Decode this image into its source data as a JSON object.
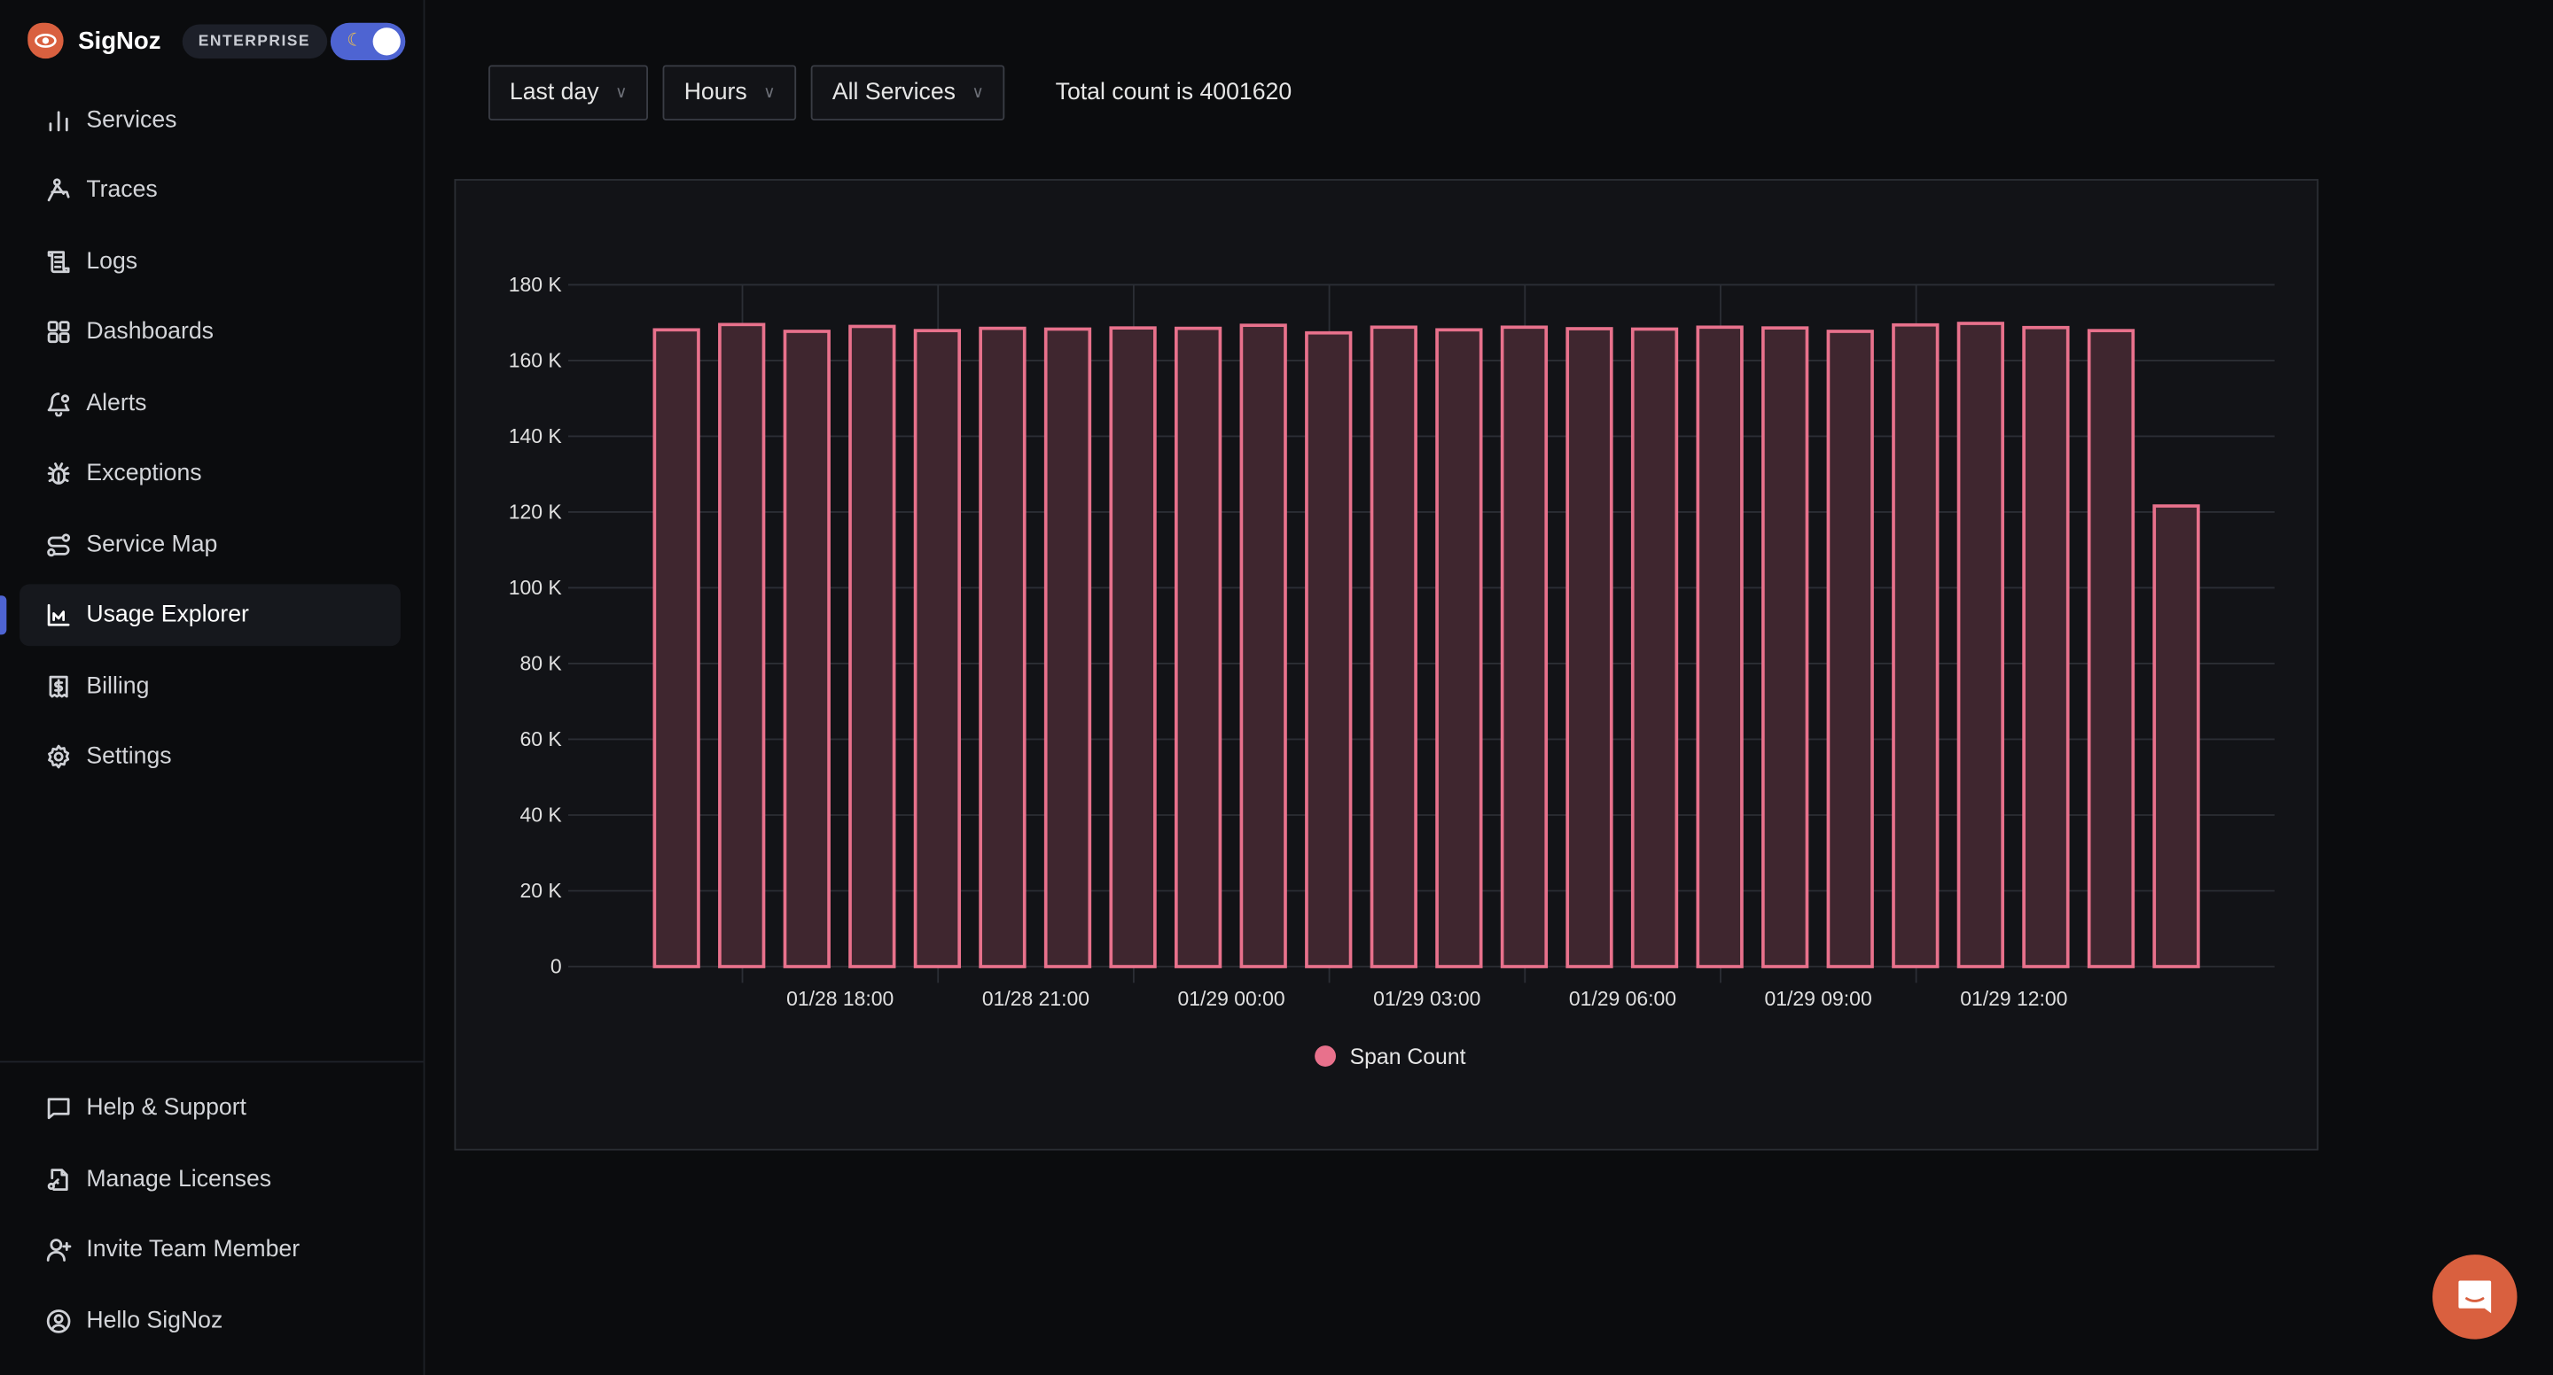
{
  "brand": {
    "name": "SigNoz",
    "badge": "ENTERPRISE",
    "theme_toggle": "dark"
  },
  "sidebar": {
    "items": [
      {
        "label": "Services",
        "icon": "bar-chart-icon"
      },
      {
        "label": "Traces",
        "icon": "traces-icon"
      },
      {
        "label": "Logs",
        "icon": "scroll-icon"
      },
      {
        "label": "Dashboards",
        "icon": "grid-icon"
      },
      {
        "label": "Alerts",
        "icon": "bell-icon"
      },
      {
        "label": "Exceptions",
        "icon": "bug-icon"
      },
      {
        "label": "Service Map",
        "icon": "route-icon"
      },
      {
        "label": "Usage Explorer",
        "icon": "area-chart-icon",
        "active": true
      },
      {
        "label": "Billing",
        "icon": "receipt-icon"
      },
      {
        "label": "Settings",
        "icon": "gear-icon"
      }
    ],
    "footer_items": [
      {
        "label": "Help & Support",
        "icon": "message-icon"
      },
      {
        "label": "Manage Licenses",
        "icon": "file-key-icon"
      },
      {
        "label": "Invite Team Member",
        "icon": "user-plus-icon"
      },
      {
        "label": "Hello SigNoz",
        "icon": "user-circle-icon"
      }
    ]
  },
  "toolbar": {
    "time_range": "Last day",
    "granularity": "Hours",
    "service": "All Services",
    "total_text": "Total count is 4001620"
  },
  "colors": {
    "accent": "#4e64d2",
    "bar_stroke": "#e8718c",
    "bar_fill": "#3f262f",
    "brand": "#d9603f"
  },
  "chart_data": {
    "type": "bar",
    "title": "",
    "xlabel": "",
    "ylabel": "",
    "ylim": [
      0,
      180000
    ],
    "yticks": [
      0,
      20000,
      40000,
      60000,
      80000,
      100000,
      120000,
      140000,
      160000,
      180000
    ],
    "ytick_labels": [
      "0",
      "20 K",
      "40 K",
      "60 K",
      "80 K",
      "100 K",
      "120 K",
      "140 K",
      "160 K",
      "180 K"
    ],
    "xtick_labels": [
      "01/28 18:00",
      "01/28 21:00",
      "01/29 00:00",
      "01/29 03:00",
      "01/29 06:00",
      "01/29 09:00",
      "01/29 12:00"
    ],
    "grid": true,
    "legend": "bottom-center",
    "series": [
      {
        "name": "Span Count",
        "values": [
          168100,
          169500,
          167700,
          169000,
          167900,
          168500,
          168300,
          168600,
          168500,
          169300,
          167300,
          168800,
          168100,
          168800,
          168400,
          168300,
          168800,
          168600,
          167700,
          169400,
          169800,
          168700,
          167900,
          121600
        ]
      }
    ]
  }
}
